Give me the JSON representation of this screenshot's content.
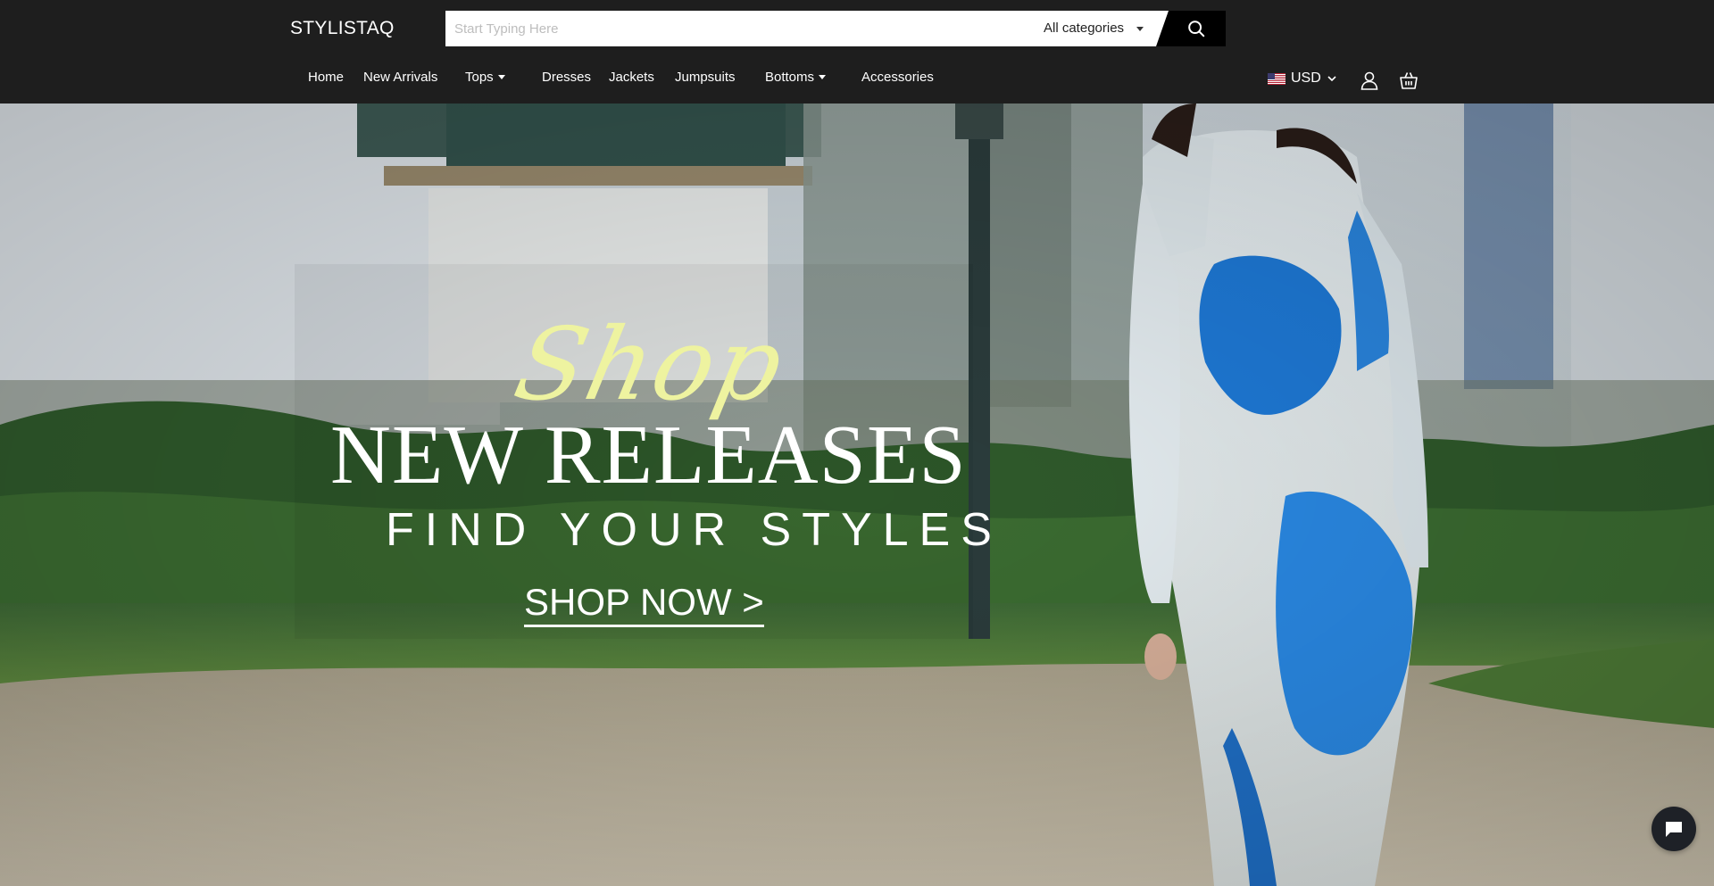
{
  "header": {
    "logo": "STYLISTAQ",
    "search": {
      "placeholder": "Start Typing Here",
      "category": "All categories",
      "search_icon": "search-icon"
    }
  },
  "nav": {
    "items": [
      {
        "label": "Home"
      },
      {
        "label": "New Arrivals"
      },
      {
        "label": "Tops",
        "dropdown": true
      },
      {
        "label": "Dresses"
      },
      {
        "label": "Jackets"
      },
      {
        "label": "Jumpsuits"
      },
      {
        "label": "Bottoms",
        "dropdown": true
      },
      {
        "label": "Accessories"
      }
    ],
    "currency": {
      "label": "USD",
      "flag": "us-flag-icon"
    },
    "icons": [
      "user-icon",
      "shopping-basket-icon"
    ]
  },
  "hero": {
    "script_text": "Shop",
    "title": "NEW RELEASES",
    "subtitle": "FIND YOUR STYLES",
    "cta": "SHOP NOW >"
  },
  "chat": {
    "icon": "chat-bubble-icon"
  },
  "colors": {
    "header_bg": "#1e1e1e",
    "search_button_bg": "#000000",
    "script_accent": "#eef3a0",
    "text_light": "#ffffff"
  }
}
